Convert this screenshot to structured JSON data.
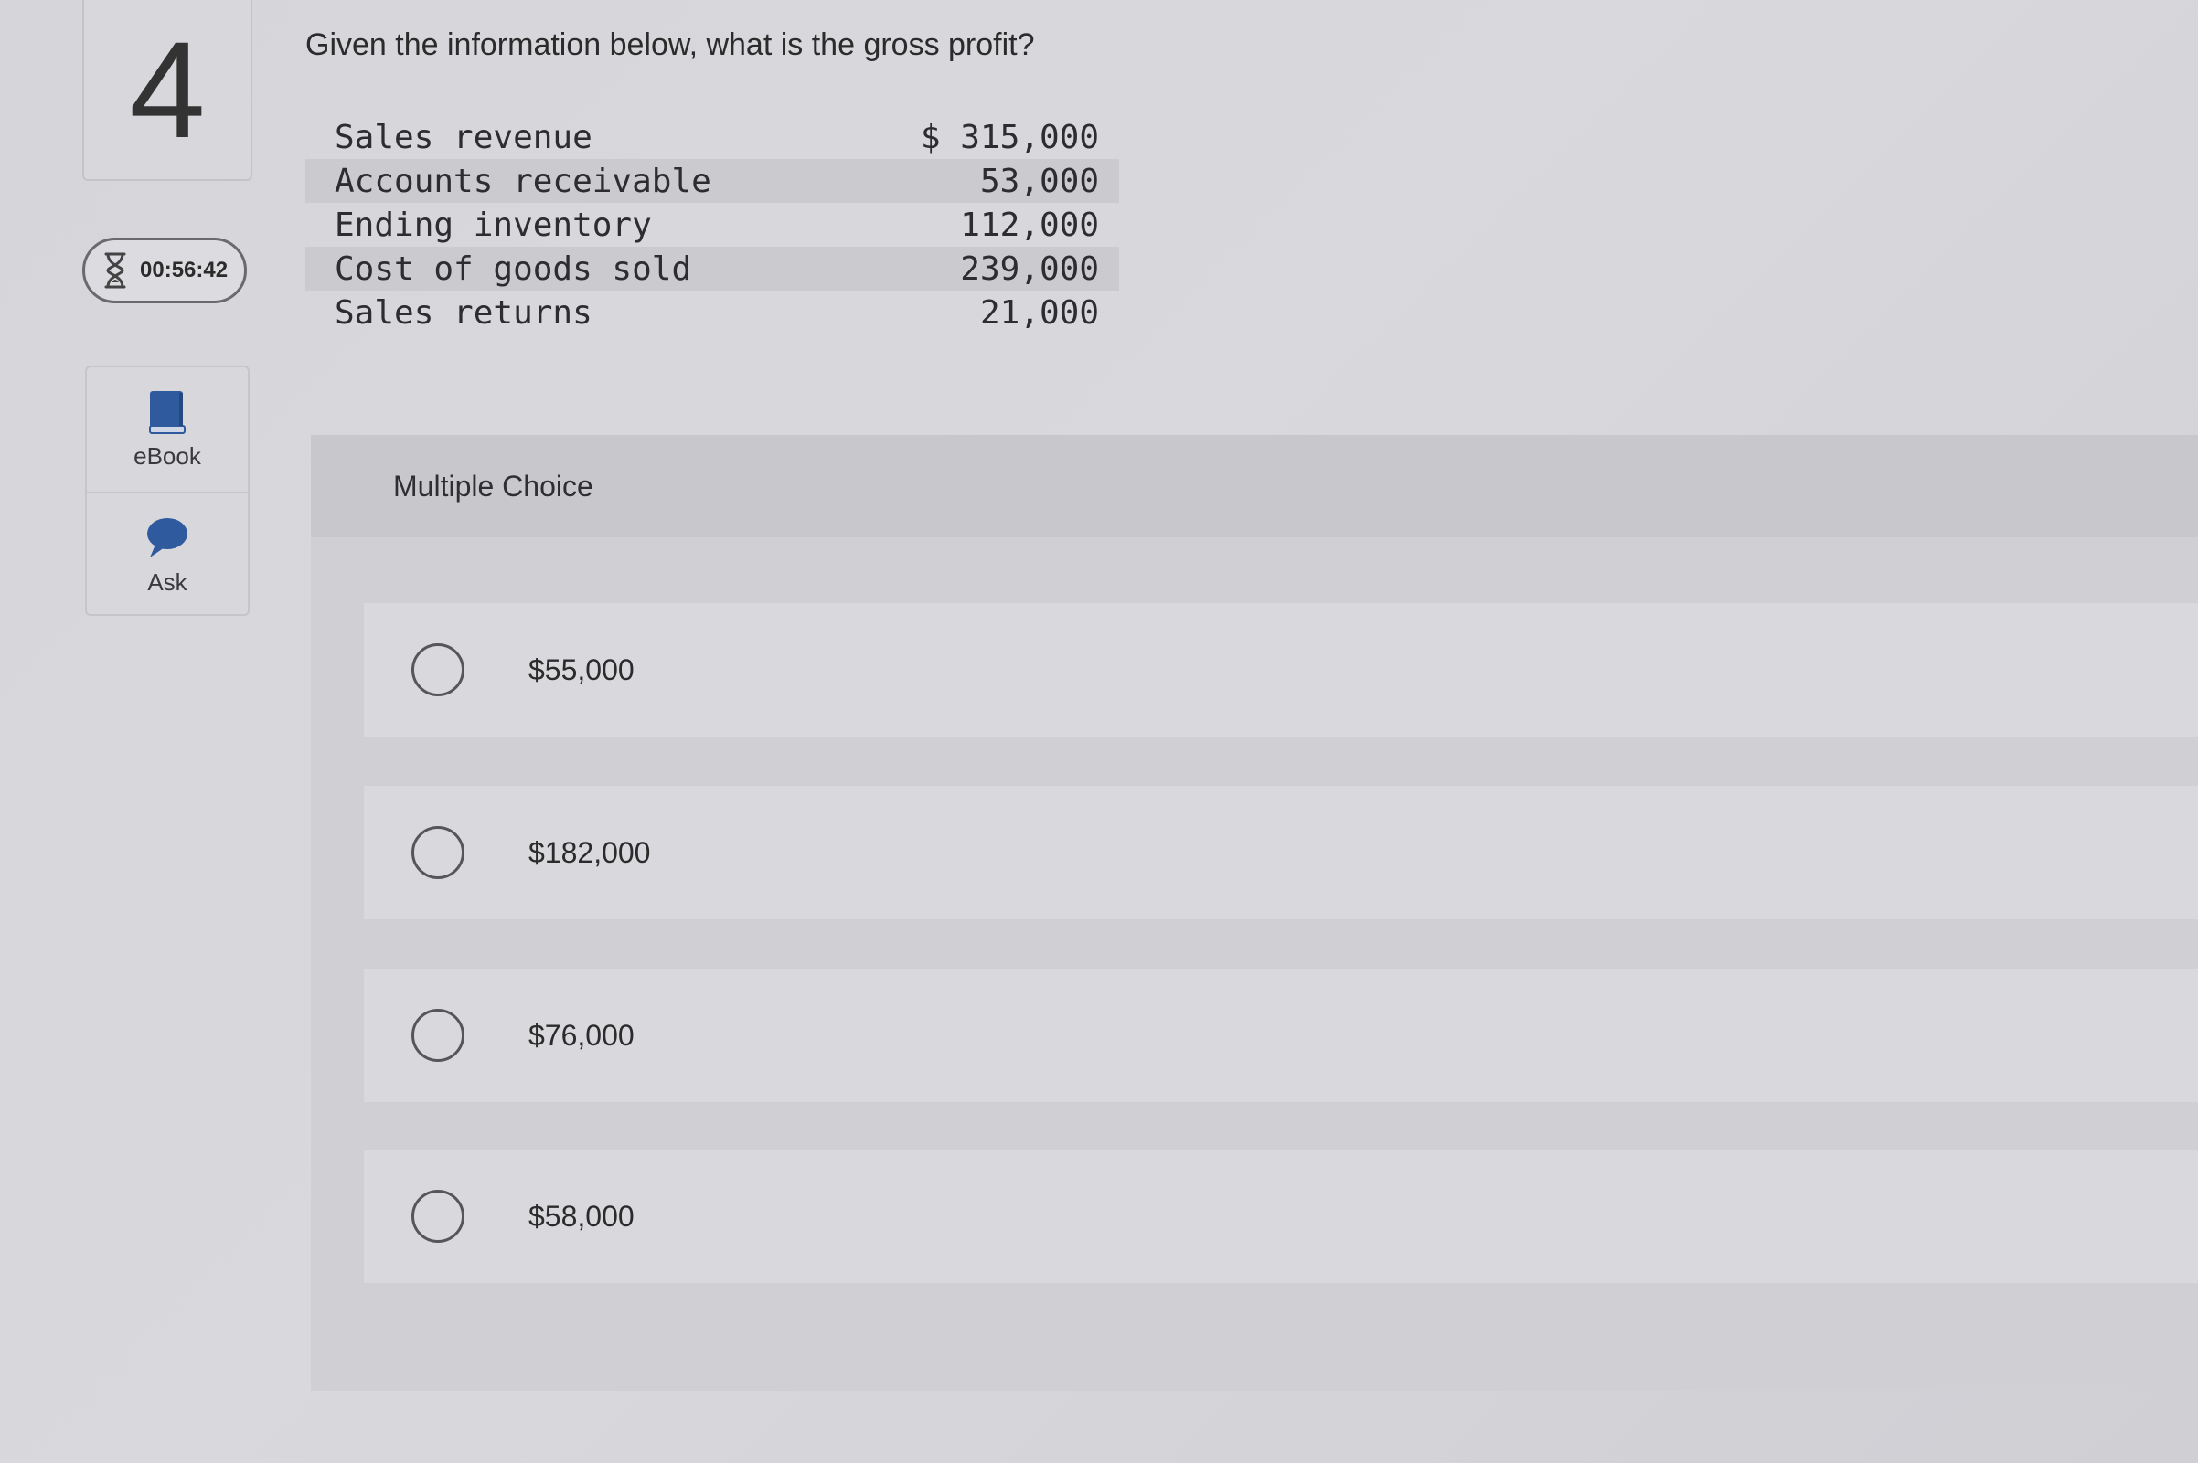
{
  "question_number": "4",
  "timer": {
    "icon": "hourglass-icon",
    "value": "00:56:42"
  },
  "tools": [
    {
      "label": "eBook",
      "icon": "book-icon"
    },
    {
      "label": "Ask",
      "icon": "chat-bubble-icon"
    }
  ],
  "question": {
    "prompt": "Given the information below, what is the gross profit?",
    "table": [
      {
        "label": "Sales revenue",
        "value": "$ 315,000"
      },
      {
        "label": "Accounts receivable",
        "value": "53,000"
      },
      {
        "label": "Ending inventory",
        "value": "112,000"
      },
      {
        "label": "Cost of goods sold",
        "value": "239,000"
      },
      {
        "label": "Sales returns",
        "value": "21,000"
      }
    ]
  },
  "multiple_choice": {
    "header": "Multiple Choice",
    "options": [
      {
        "label": "$55,000"
      },
      {
        "label": "$182,000"
      },
      {
        "label": "$76,000"
      },
      {
        "label": "$58,000"
      }
    ]
  },
  "colors": {
    "background": "#d6d6da",
    "panel": "#d0d0d4",
    "accent_blue": "#2f5a9e"
  }
}
